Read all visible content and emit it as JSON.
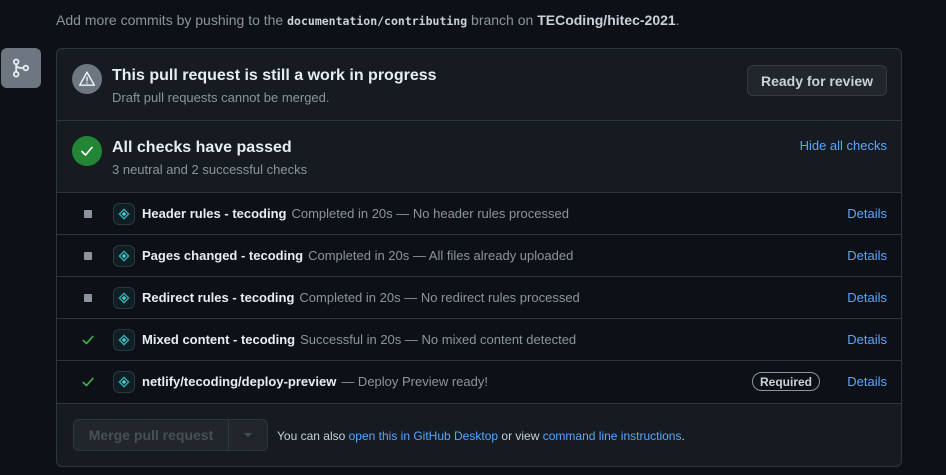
{
  "commit_note": {
    "prefix": "Add more commits by pushing to the",
    "branch": "documentation/contributing",
    "middle": "branch on",
    "repo": "TECoding/hitec-2021",
    "suffix": "."
  },
  "draft": {
    "title": "This pull request is still a work in progress",
    "subtitle": "Draft pull requests cannot be merged.",
    "ready_button": "Ready for review",
    "icon": "alert-icon"
  },
  "checks_summary": {
    "title": "All checks have passed",
    "subtitle": "3 neutral and 2 successful checks",
    "hide_link": "Hide all checks",
    "icon": "check-circle-icon"
  },
  "checks": [
    {
      "status": "neutral",
      "name": "Header rules - tecoding",
      "description": "Completed in 20s — No header rules processed",
      "details": "Details"
    },
    {
      "status": "neutral",
      "name": "Pages changed - tecoding",
      "description": "Completed in 20s — All files already uploaded",
      "details": "Details"
    },
    {
      "status": "neutral",
      "name": "Redirect rules - tecoding",
      "description": "Completed in 20s — No redirect rules processed",
      "details": "Details"
    },
    {
      "status": "success",
      "name": "Mixed content - tecoding",
      "description": "Successful in 20s — No mixed content detected",
      "details": "Details"
    },
    {
      "status": "success",
      "name": "netlify/tecoding/deploy-preview",
      "description": "— Deploy Preview ready!",
      "details": "Details",
      "badge": "Required"
    }
  ],
  "merge": {
    "button": "Merge pull request",
    "note_prefix": "You can also",
    "desktop_link": "open this in GitHub Desktop",
    "note_middle": "or view",
    "cli_link": "command line instructions",
    "note_suffix": "."
  },
  "colors": {
    "background": "#0d1117",
    "panel": "#161b22",
    "border": "#30363d",
    "link": "#58a6ff",
    "success": "#238636",
    "success_check": "#3fb950",
    "neutral": "#8b949e"
  }
}
